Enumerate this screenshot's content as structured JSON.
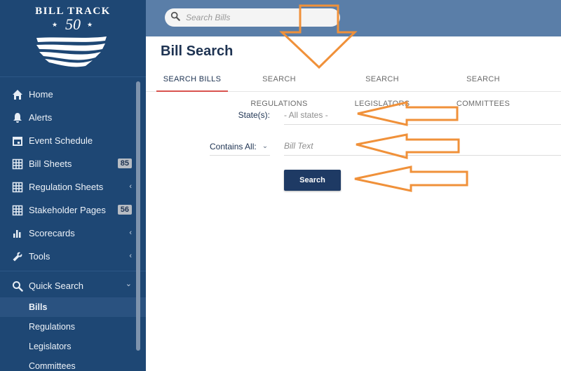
{
  "logo": {
    "line1": "BILL TRACK",
    "line2": "50",
    "star": "★"
  },
  "header": {
    "search_placeholder": "Search Bills"
  },
  "page": {
    "title": "Bill Search"
  },
  "tabs": [
    {
      "label": "SEARCH BILLS",
      "active": true
    },
    {
      "label": "SEARCH REGULATIONS",
      "active": false
    },
    {
      "label": "SEARCH LEGISLATORS",
      "active": false
    },
    {
      "label": "SEARCH COMMITTEES",
      "active": false
    }
  ],
  "sidebar": {
    "items": [
      {
        "label": "Home",
        "icon": "home-icon"
      },
      {
        "label": "Alerts",
        "icon": "bell-icon"
      },
      {
        "label": "Event Schedule",
        "icon": "calendar-icon"
      },
      {
        "label": "Bill Sheets",
        "icon": "grid-icon",
        "badge": "85"
      },
      {
        "label": "Regulation Sheets",
        "icon": "grid-icon",
        "chevron": "‹"
      },
      {
        "label": "Stakeholder Pages",
        "icon": "grid-icon",
        "badge": "56"
      },
      {
        "label": "Scorecards",
        "icon": "bar-chart-icon",
        "chevron": "‹"
      },
      {
        "label": "Tools",
        "icon": "wrench-icon",
        "chevron": "‹"
      }
    ],
    "quick_search": {
      "label": "Quick Search",
      "icon": "search-icon",
      "chevron": "⌄",
      "children": [
        "Bills",
        "Regulations",
        "Legislators",
        "Committees"
      ]
    }
  },
  "form": {
    "states_label": "State(s):",
    "states_placeholder": "- All states -",
    "contains_label": "Contains All:",
    "contains_chevron": "⌄",
    "text_placeholder": "Bill Text",
    "search_button": "Search"
  },
  "colors": {
    "sidebar": "#1e4774",
    "topbar": "#5a7ea8",
    "primary": "#1e3a64",
    "tab_underline": "#d9534f",
    "annotation": "#f0913a"
  }
}
